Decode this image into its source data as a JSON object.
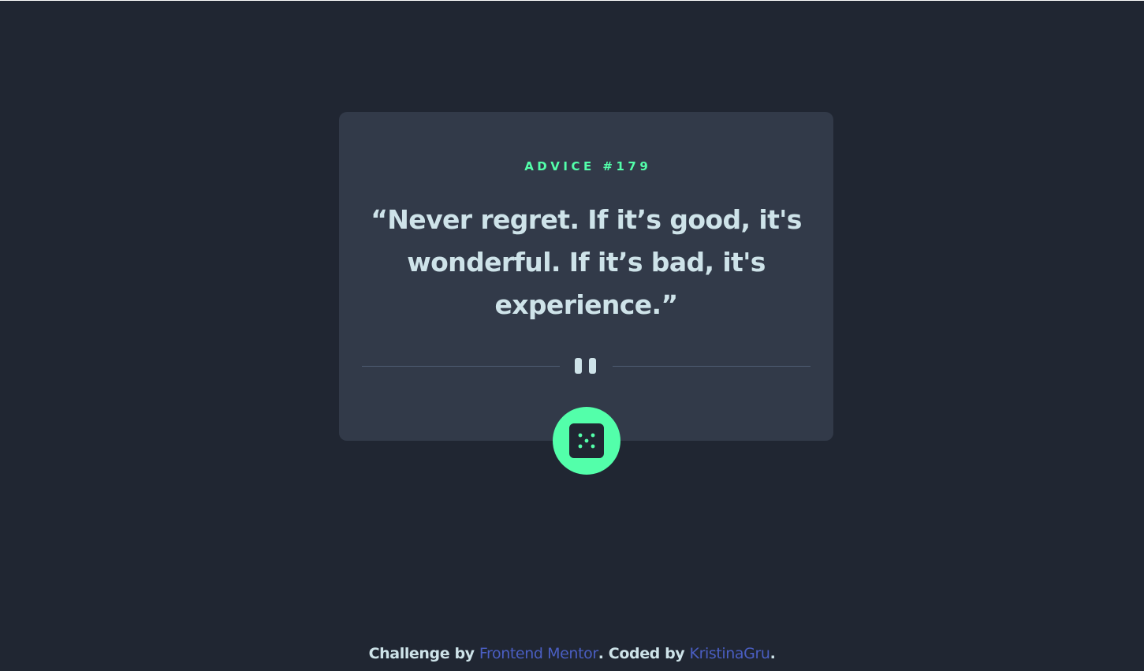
{
  "advice": {
    "label": "ADVICE #179",
    "quote": "“Never regret. If it’s good, it's wonderful. If it’s bad, it's experience.”"
  },
  "icons": {
    "divider": "pause-icon",
    "button": "dice-icon"
  },
  "footer": {
    "prefix": "Challenge by",
    "link1": "Frontend Mentor",
    "middle": ". Coded by",
    "link2": "KristinaGru",
    "suffix": "."
  },
  "colors": {
    "background": "#202632",
    "card": "#323a49",
    "accent": "#53ffaa",
    "text": "#cee3e9",
    "link": "#4a5ec2"
  }
}
